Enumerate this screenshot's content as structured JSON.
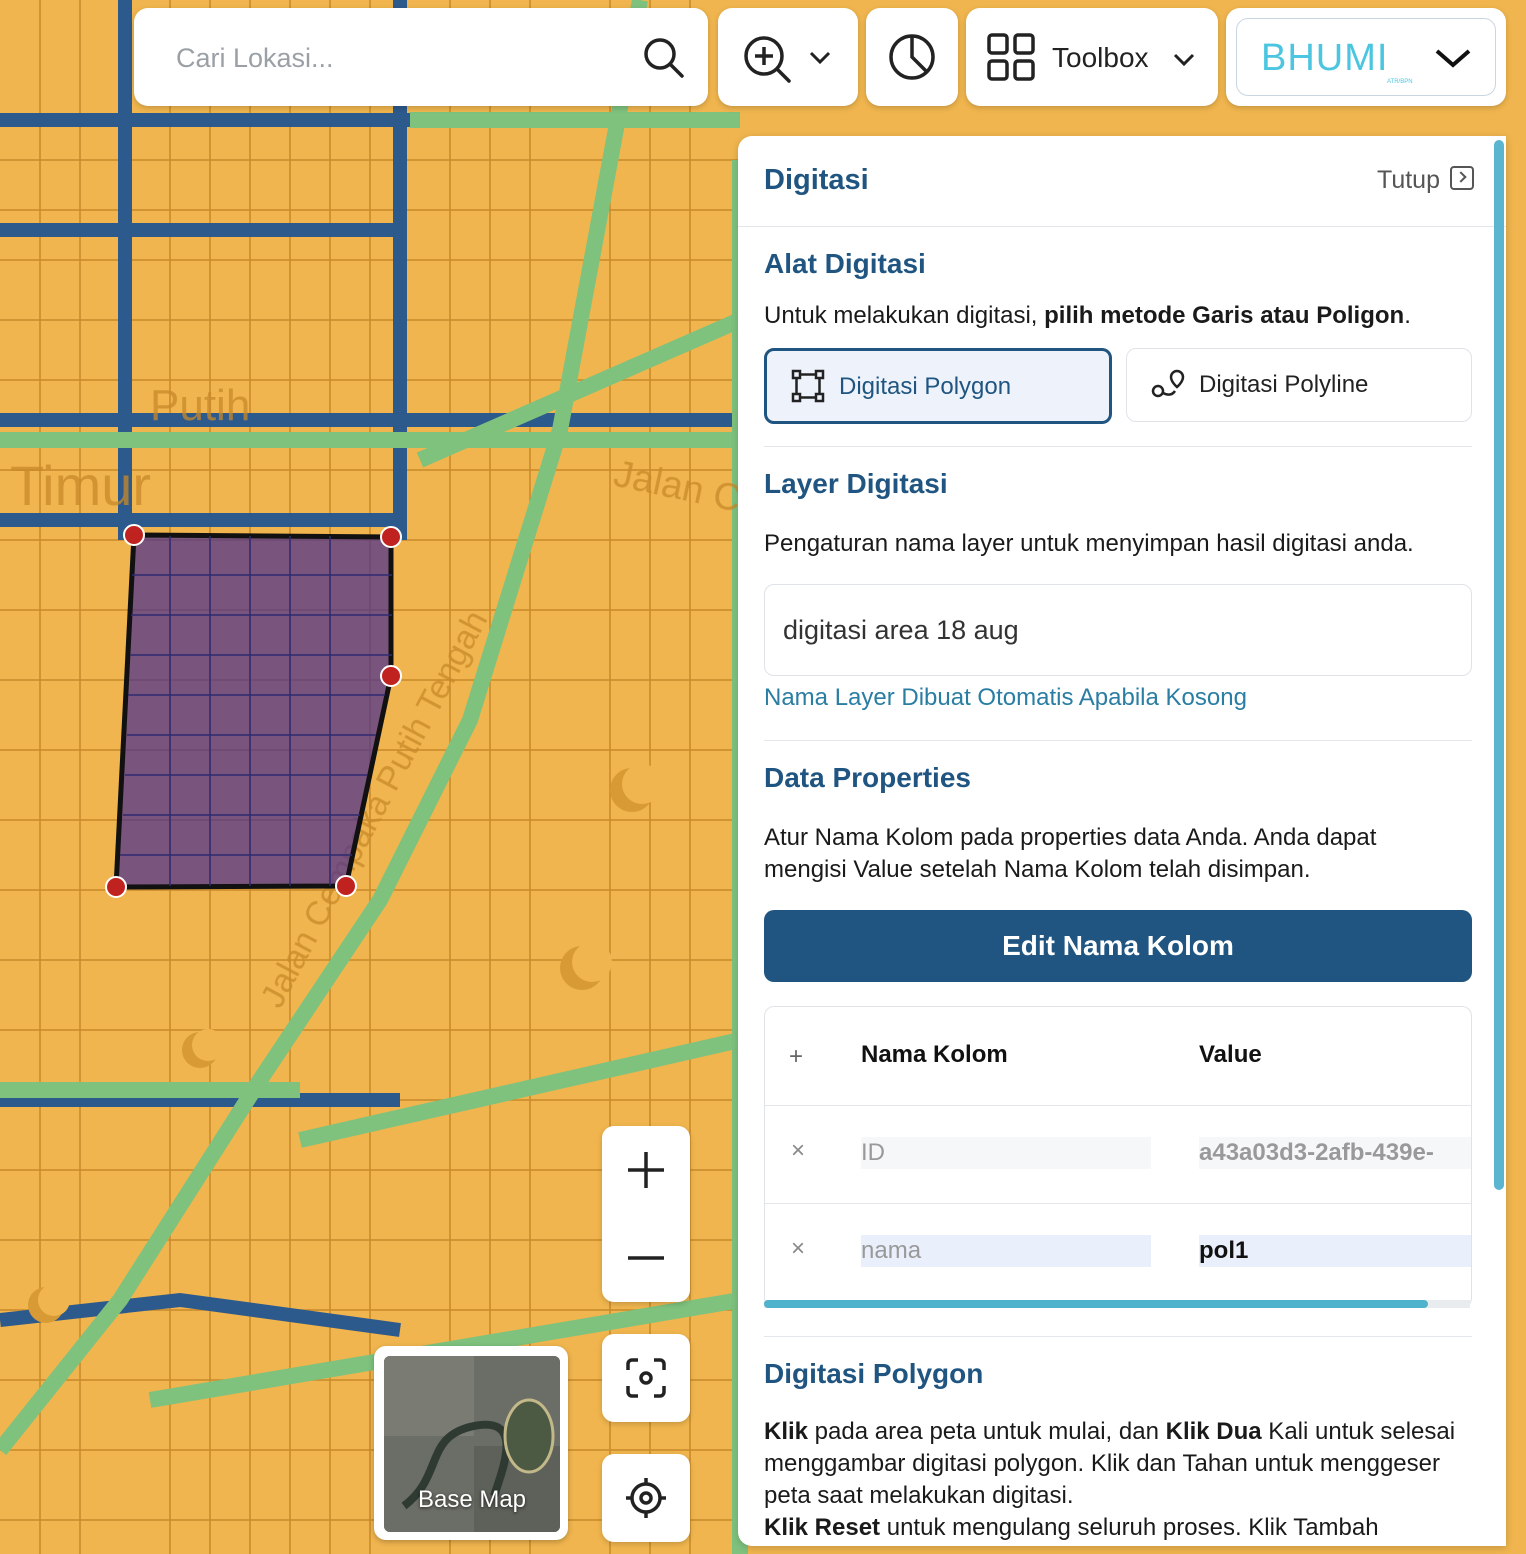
{
  "search": {
    "placeholder": "Cari Lokasi..."
  },
  "toolbar": {
    "toolbox_label": "Toolbox",
    "brand": "BHUMI",
    "brand_sub": "ATR/BPN"
  },
  "map": {
    "street_labels": [
      "Jalan Ce",
      "Jalan Cempaka Putih Tengah",
      "Timur",
      "Putih"
    ]
  },
  "panel": {
    "title": "Digitasi",
    "close_label": "Tutup",
    "tools": {
      "heading": "Alat Digitasi",
      "text_plain": "Untuk melakukan digitasi, ",
      "text_bold": "pilih metode Garis atau Poligon",
      "text_end": ".",
      "polygon_label": "Digitasi Polygon",
      "polyline_label": "Digitasi Polyline"
    },
    "layer": {
      "heading": "Layer Digitasi",
      "text": "Pengaturan nama layer untuk menyimpan hasil digitasi anda.",
      "value": "digitasi area 18 aug",
      "hint": "Nama Layer Dibuat Otomatis Apabila Kosong"
    },
    "props": {
      "heading": "Data Properties",
      "text": "Atur Nama Kolom pada properties data Anda. Anda dapat mengisi Value setelah Nama Kolom telah disimpan.",
      "edit_label": "Edit Nama Kolom",
      "table": {
        "add_symbol": "+",
        "col_name": "Nama Kolom",
        "col_value": "Value",
        "rows": [
          {
            "remove": "×",
            "name": "ID",
            "value": "a43a03d3-2afb-439e-"
          },
          {
            "remove": "×",
            "name": "nama",
            "value": "pol1"
          }
        ]
      }
    },
    "polygon_help": {
      "heading": "Digitasi Polygon",
      "p1_b1": "Klik",
      "p1_t1": " pada area peta untuk mulai, dan ",
      "p1_b2": "Klik Dua",
      "p1_t2": " Kali untuk selesai menggambar digitasi polygon. Klik dan Tahan untuk menggeser peta saat melakukan digitasi.",
      "p2_b1": "Klik Reset",
      "p2_t1": " untuk mengulang seluruh proses. Klik Tambah"
    }
  },
  "controls": {
    "basemap_label": "Base Map"
  },
  "colors": {
    "primary": "#1f5580",
    "parcel": "#f0b54e",
    "road": "#2d5a8c",
    "green": "#7ec27e",
    "polygon": "#4b2f8f",
    "vertex": "#c0221f"
  }
}
